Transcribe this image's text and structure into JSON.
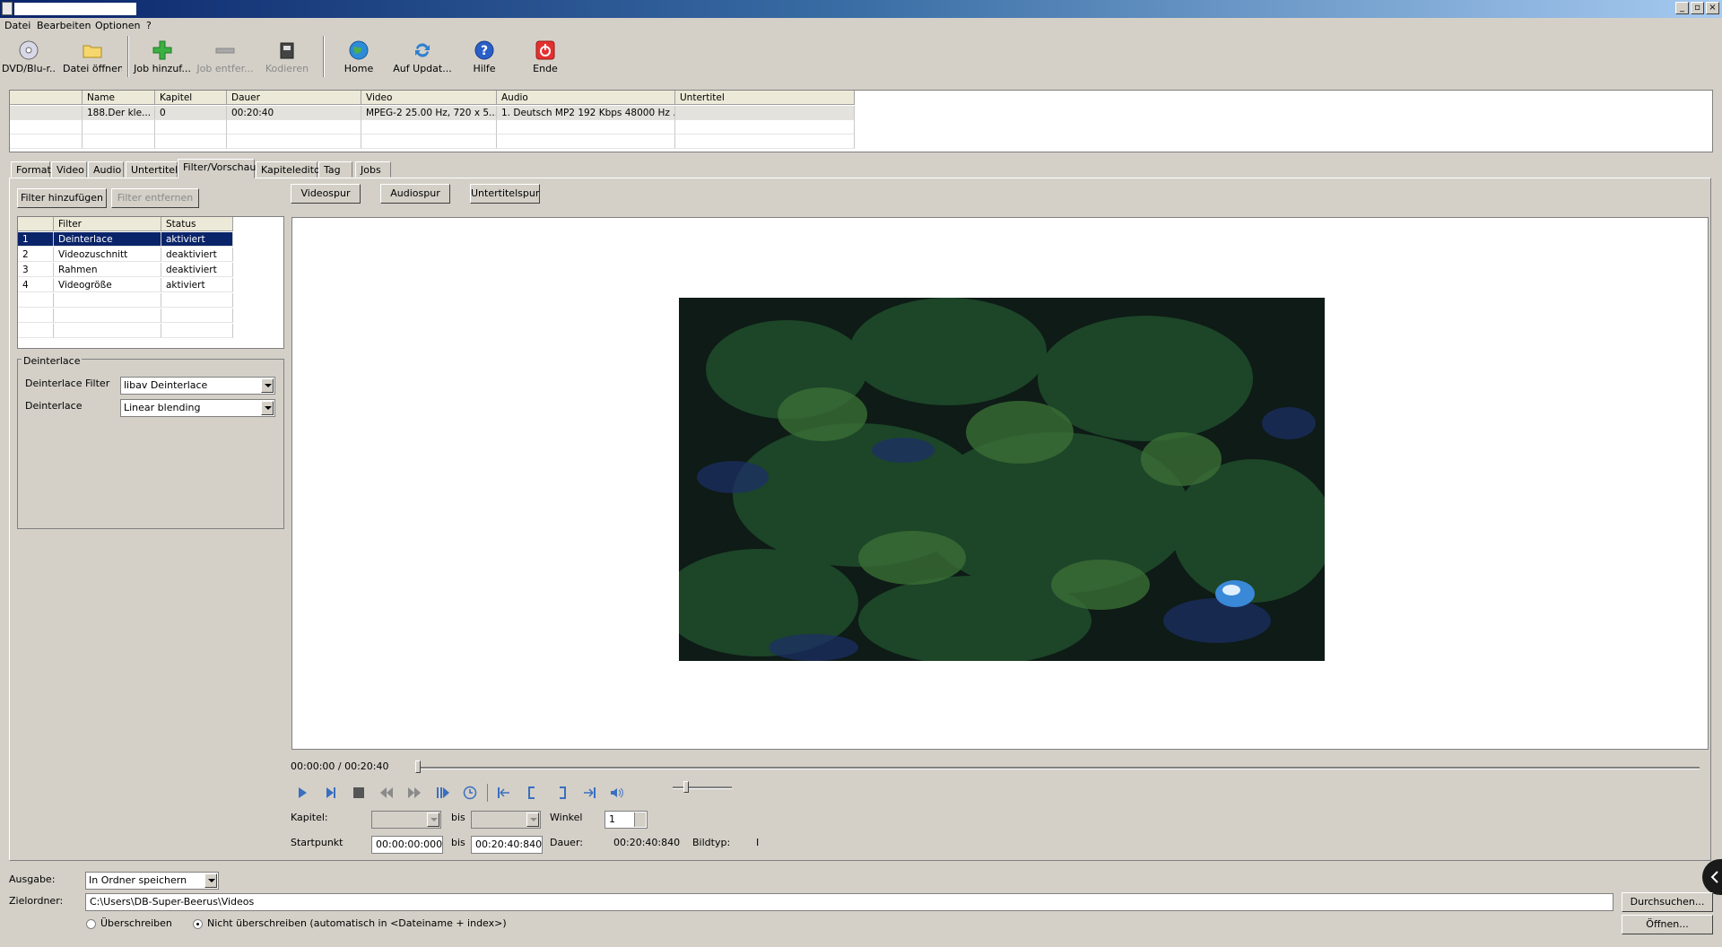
{
  "window": {
    "title": ""
  },
  "menu": [
    "Datei",
    "Bearbeiten",
    "Optionen",
    "?"
  ],
  "toolbar": [
    {
      "label": "DVD/Blu-r...",
      "icon": "disc-icon",
      "enabled": true
    },
    {
      "label": "Datei öffnen",
      "icon": "folder-icon",
      "enabled": true
    },
    {
      "label": "Job hinzuf...",
      "icon": "plus-icon",
      "enabled": true
    },
    {
      "label": "Job entfer...",
      "icon": "minus-icon",
      "enabled": false
    },
    {
      "label": "Kodieren",
      "icon": "film-icon",
      "enabled": false
    },
    {
      "label": "Home",
      "icon": "globe-icon",
      "enabled": true
    },
    {
      "label": "Auf Updat...",
      "icon": "refresh-icon",
      "enabled": true
    },
    {
      "label": "Hilfe",
      "icon": "help-icon",
      "enabled": true
    },
    {
      "label": "Ende",
      "icon": "power-icon",
      "enabled": true
    }
  ],
  "jobs": {
    "headers": [
      "",
      "Name",
      "Kapitel",
      "Dauer",
      "Video",
      "Audio",
      "Untertitel"
    ],
    "rows": [
      [
        "",
        "188.Der kle...",
        "0",
        "00:20:40",
        "MPEG-2 25.00 Hz, 720 x 5...",
        "1. Deutsch MP2 192 Kbps 48000 Hz ...",
        ""
      ]
    ]
  },
  "tabs": [
    "Format",
    "Video",
    "Audio",
    "Untertitel",
    "Filter/Vorschau",
    "Kapiteleditor",
    "Tag",
    "Jobs"
  ],
  "active_tab": "Filter/Vorschau",
  "filter_panel": {
    "add_label": "Filter hinzufügen",
    "remove_label": "Filter entfernen",
    "headers": [
      "",
      "Filter",
      "Status"
    ],
    "rows": [
      {
        "num": "1",
        "name": "Deinterlace",
        "status": "aktiviert"
      },
      {
        "num": "2",
        "name": "Videozuschnitt",
        "status": "deaktiviert"
      },
      {
        "num": "3",
        "name": "Rahmen",
        "status": "deaktiviert"
      },
      {
        "num": "4",
        "name": "Videogröße",
        "status": "aktiviert"
      }
    ]
  },
  "deinterlace": {
    "group_title": "Deinterlace",
    "filter_label": "Deinterlace Filter",
    "filter_value": "libav Deinterlace",
    "mode_label": "Deinterlace",
    "mode_value": "Linear blending"
  },
  "track_buttons": [
    "Videospur",
    "Audiospur",
    "Untertitelspur"
  ],
  "player": {
    "time": "00:00:00 / 00:20:40",
    "position_fraction": 0.0
  },
  "range": {
    "kapitel_label": "Kapitel:",
    "bis_label": "bis",
    "winkel_label": "Winkel",
    "winkel_value": "1",
    "start_label": "Startpunkt",
    "start_value": "00:00:00:000",
    "end_value": "00:20:40:840",
    "dauer_label": "Dauer:",
    "dauer_value": "00:20:40:840",
    "bildtyp_label": "Bildtyp:",
    "bildtyp_value": "I"
  },
  "output": {
    "ausgabe_label": "Ausgabe:",
    "ausgabe_value": "In Ordner speichern",
    "ziel_label": "Zielordner:",
    "ziel_value": "C:\\Users\\DB-Super-Beerus\\Videos",
    "browse_label": "Durchsuchen...",
    "open_label": "Öffnen...",
    "overwrite_label": "Überschreiben",
    "no_overwrite_label": "Nicht überschreiben (automatisch in <Dateiname + index>)"
  }
}
